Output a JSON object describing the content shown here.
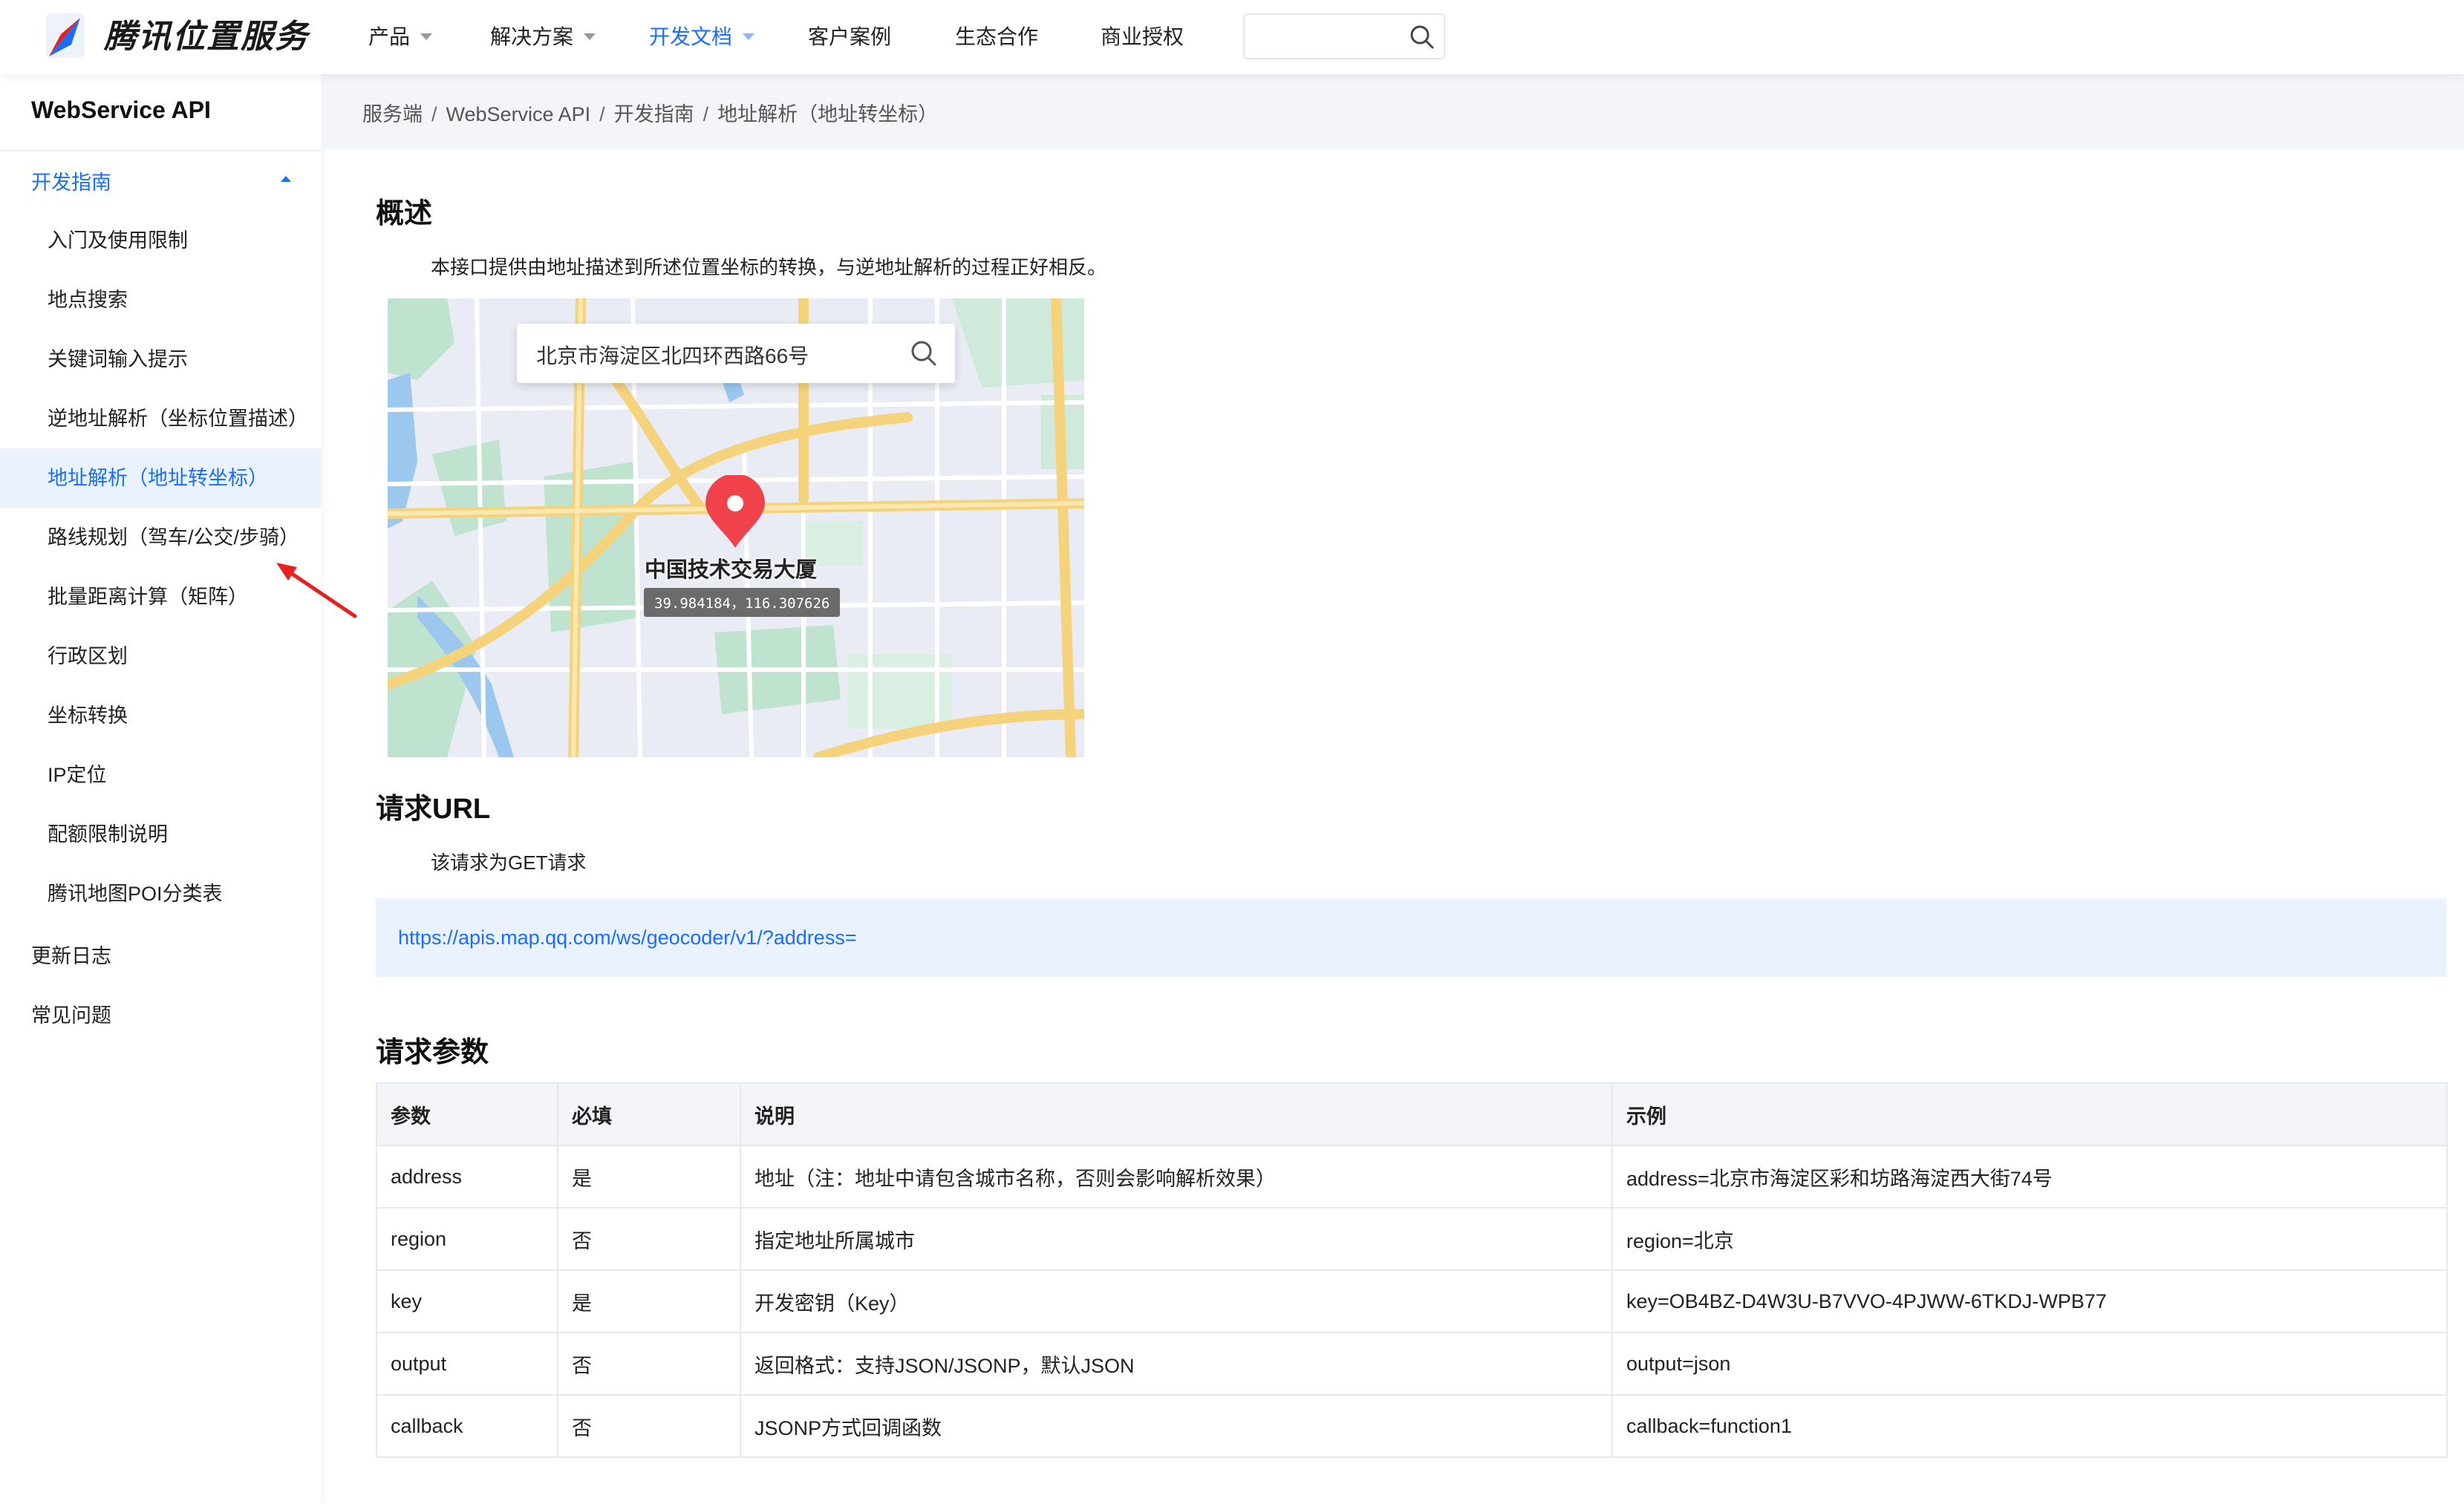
{
  "brand": {
    "name": "腾讯位置服务"
  },
  "nav": {
    "items": [
      {
        "label": "产品",
        "dropdown": true
      },
      {
        "label": "解决方案",
        "dropdown": true
      },
      {
        "label": "开发文档",
        "dropdown": true,
        "active": true
      },
      {
        "label": "客户案例"
      },
      {
        "label": "生态合作"
      },
      {
        "label": "商业授权"
      }
    ],
    "search": {
      "value": "",
      "placeholder": ""
    }
  },
  "sidebar": {
    "title": "WebService API",
    "group": "开发指南",
    "items": [
      "入门及使用限制",
      "地点搜索",
      "关键词输入提示",
      "逆地址解析（坐标位置描述）",
      "地址解析（地址转坐标）",
      "路线规划（驾车/公交/步骑）",
      "批量距离计算（矩阵）",
      "行政区划",
      "坐标转换",
      "IP定位",
      "配额限制说明",
      "腾讯地图POI分类表"
    ],
    "active_index": 4,
    "top_items": [
      "更新日志",
      "常见问题"
    ]
  },
  "breadcrumb": [
    "服务端",
    "WebService API",
    "开发指南",
    "地址解析（地址转坐标）"
  ],
  "overview": {
    "title": "概述",
    "text": "本接口提供由地址描述到所述位置坐标的转换，与逆地址解析的过程正好相反。",
    "map": {
      "search_text": "北京市海淀区北四环西路66号",
      "place": "中国技术交易大厦",
      "coords": "39.984184，116.307626"
    }
  },
  "request_url": {
    "title": "请求URL",
    "text": "该请求为GET请求",
    "url": "https://apis.map.qq.com/ws/geocoder/v1/?address="
  },
  "params": {
    "title": "请求参数",
    "headers": [
      "参数",
      "必填",
      "说明",
      "示例"
    ],
    "rows": [
      [
        "address",
        "是",
        "地址（注：地址中请包含城市名称，否则会影响解析效果）",
        "address=北京市海淀区彩和坊路海淀西大街74号"
      ],
      [
        "region",
        "否",
        "指定地址所属城市",
        "region=北京"
      ],
      [
        "key",
        "是",
        "开发密钥（Key）",
        "key=OB4BZ-D4W3U-B7VVO-4PJWW-6TKDJ-WPB77"
      ],
      [
        "output",
        "否",
        "返回格式：支持JSON/JSONP，默认JSON",
        "output=json"
      ],
      [
        "callback",
        "否",
        "JSONP方式回调函数",
        "callback=function1"
      ]
    ]
  },
  "colors": {
    "accent": "#1a6dff",
    "active_bg": "#ebf2ff",
    "arrow": "#e8211f",
    "pin": "#f0424b"
  }
}
